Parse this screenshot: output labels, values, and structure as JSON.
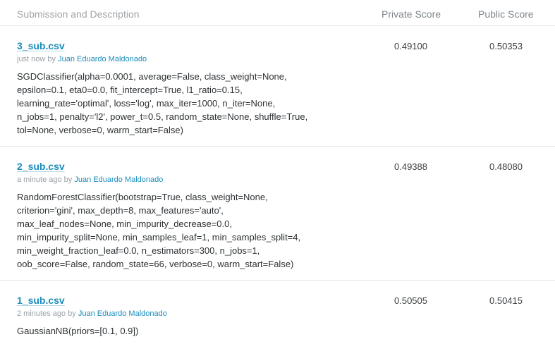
{
  "header": {
    "description": "Submission and Description",
    "private": "Private Score",
    "public": "Public Score"
  },
  "submissions": [
    {
      "filename": "3_sub.csv",
      "time": "just now",
      "by": "by",
      "author": "Juan Eduardo Maldonado",
      "description": [
        "SGDClassifier(alpha=0.0001, average=False, class_weight=None,",
        "epsilon=0.1, eta0=0.0, fit_intercept=True, l1_ratio=0.15,",
        "learning_rate='optimal', loss='log', max_iter=1000, n_iter=None,",
        "n_jobs=1, penalty='l2', power_t=0.5, random_state=None, shuffle=True,",
        "tol=None, verbose=0, warm_start=False)"
      ],
      "private_score": "0.49100",
      "public_score": "0.50353"
    },
    {
      "filename": "2_sub.csv",
      "time": "a minute ago",
      "by": "by",
      "author": "Juan Eduardo Maldonado",
      "description": [
        "RandomForestClassifier(bootstrap=True, class_weight=None,",
        "criterion='gini', max_depth=8, max_features='auto',",
        "max_leaf_nodes=None, min_impurity_decrease=0.0,",
        "min_impurity_split=None, min_samples_leaf=1, min_samples_split=4,",
        "min_weight_fraction_leaf=0.0, n_estimators=300, n_jobs=1,",
        "oob_score=False, random_state=66, verbose=0, warm_start=False)"
      ],
      "private_score": "0.49388",
      "public_score": "0.48080"
    },
    {
      "filename": "1_sub.csv",
      "time": "2 minutes ago",
      "by": "by",
      "author": "Juan Eduardo Maldonado",
      "description": [
        "GaussianNB(priors=[0.1, 0.9])"
      ],
      "private_score": "0.50505",
      "public_score": "0.50415"
    }
  ]
}
